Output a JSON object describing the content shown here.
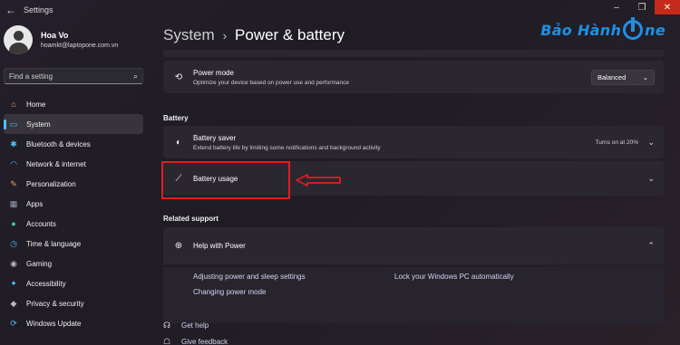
{
  "window": {
    "app_title": "Settings",
    "back_icon": "back-arrow-icon",
    "minimize": "–",
    "maximize": "❐",
    "close": "✕"
  },
  "profile": {
    "name": "Hoa Vo",
    "email": "hoamkt@laptopone.com.vn"
  },
  "search": {
    "placeholder": "Find a setting"
  },
  "sidebar": {
    "items": [
      {
        "label": "Home",
        "icon": "home-icon",
        "glyph": "⌂",
        "color": "#f0a35a"
      },
      {
        "label": "System",
        "icon": "system-icon",
        "glyph": "▭",
        "color": "#4cc2ff"
      },
      {
        "label": "Bluetooth & devices",
        "icon": "bluetooth-icon",
        "glyph": "✱",
        "color": "#4cc2ff"
      },
      {
        "label": "Network & internet",
        "icon": "network-icon",
        "glyph": "◠",
        "color": "#4cc2ff"
      },
      {
        "label": "Personalization",
        "icon": "personalization-icon",
        "glyph": "✎",
        "color": "#f0a35a"
      },
      {
        "label": "Apps",
        "icon": "apps-icon",
        "glyph": "▦",
        "color": "#9aa3b5"
      },
      {
        "label": "Accounts",
        "icon": "accounts-icon",
        "glyph": "●",
        "color": "#3dd68c"
      },
      {
        "label": "Time & language",
        "icon": "time-language-icon",
        "glyph": "◷",
        "color": "#4cc2ff"
      },
      {
        "label": "Gaming",
        "icon": "gaming-icon",
        "glyph": "◉",
        "color": "#b8b8b8"
      },
      {
        "label": "Accessibility",
        "icon": "accessibility-icon",
        "glyph": "✦",
        "color": "#4cc2ff"
      },
      {
        "label": "Privacy & security",
        "icon": "privacy-icon",
        "glyph": "◆",
        "color": "#b8b8b8"
      },
      {
        "label": "Windows Update",
        "icon": "windows-update-icon",
        "glyph": "⟳",
        "color": "#4cc2ff"
      }
    ],
    "active_index": 1
  },
  "breadcrumb": {
    "root": "System",
    "separator": "›",
    "current": "Power & battery"
  },
  "logo": {
    "text_left": "Bảo Hành",
    "text_right": "ne",
    "color": "#1e90e6"
  },
  "power_mode": {
    "title": "Power mode",
    "description": "Optimize your device based on power use and performance",
    "value": "Balanced"
  },
  "battery_section": {
    "label": "Battery",
    "saver": {
      "title": "Battery saver",
      "description": "Extend battery life by limiting some notifications and background activity",
      "status": "Turns on at 20%"
    },
    "usage": {
      "title": "Battery usage"
    }
  },
  "related_support": {
    "label": "Related support",
    "help": {
      "title": "Help with Power",
      "links": [
        "Adjusting power and sleep settings",
        "Lock your Windows PC automatically",
        "Changing power mode"
      ]
    }
  },
  "footer": {
    "get_help": "Get help",
    "give_feedback": "Give feedback"
  },
  "annotation": {
    "highlight_color": "#e11d1d"
  }
}
